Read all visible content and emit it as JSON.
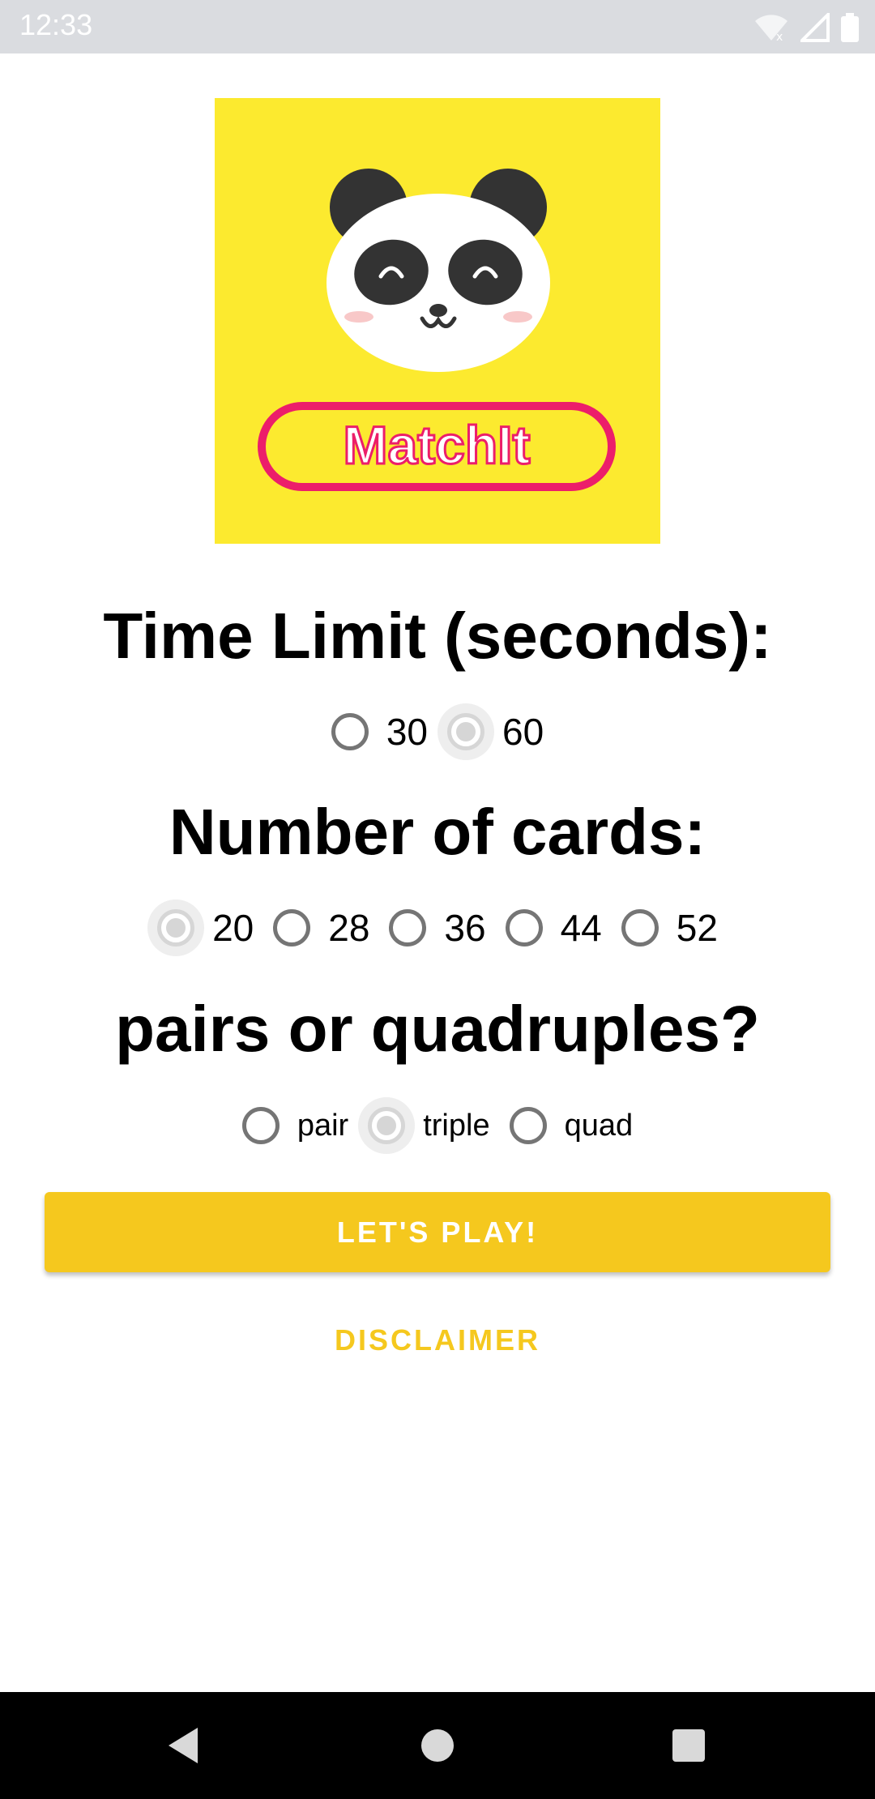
{
  "status_bar": {
    "time": "12:33",
    "icons": [
      "wifi-icon",
      "signal-icon",
      "battery-icon"
    ]
  },
  "logo": {
    "text": "MatchIt",
    "colors": {
      "background": "#fcea2f",
      "ring": "#ec1e6a",
      "panda_dark": "#333333"
    }
  },
  "time_limit": {
    "heading": "Time Limit (seconds):",
    "options": [
      {
        "label": "30",
        "checked": false
      },
      {
        "label": "60",
        "checked": true
      }
    ]
  },
  "cards": {
    "heading": "Number of cards:",
    "options": [
      {
        "label": "20",
        "checked": true
      },
      {
        "label": "28",
        "checked": false
      },
      {
        "label": "36",
        "checked": false
      },
      {
        "label": "44",
        "checked": false
      },
      {
        "label": "52",
        "checked": false
      }
    ]
  },
  "grouping": {
    "heading": "pairs or quadruples?",
    "options": [
      {
        "label": "pair",
        "checked": false
      },
      {
        "label": "triple",
        "checked": true
      },
      {
        "label": "quad",
        "checked": false
      }
    ]
  },
  "actions": {
    "play_label": "LET'S PLAY!",
    "disclaimer_label": "DISCLAIMER"
  },
  "theme": {
    "accent": "#f5c81e",
    "unchecked_radio": "#757575",
    "checked_radio_disabled": "#d6d6d6"
  },
  "nav_bar": {
    "buttons": [
      "back-icon",
      "home-icon",
      "recents-icon"
    ]
  }
}
